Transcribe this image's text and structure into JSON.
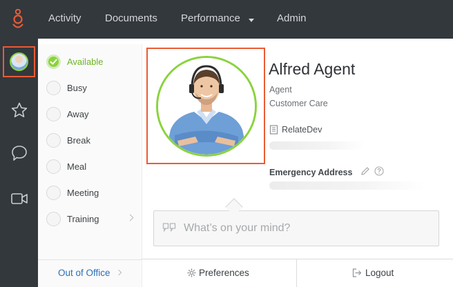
{
  "topbar": {
    "logo_icon": "genesys-logo-icon",
    "accent": "#ea5b34",
    "nav": [
      {
        "label": "Activity"
      },
      {
        "label": "Documents"
      },
      {
        "label": "Performance"
      },
      {
        "label": "Admin"
      }
    ]
  },
  "rail": {
    "items": [
      {
        "icon": "agent-avatar-icon"
      },
      {
        "icon": "star-icon"
      },
      {
        "icon": "chat-bubble-icon"
      },
      {
        "icon": "video-camera-icon"
      }
    ]
  },
  "status": {
    "items": [
      {
        "label": "Available",
        "selected": true
      },
      {
        "label": "Busy"
      },
      {
        "label": "Away"
      },
      {
        "label": "Break"
      },
      {
        "label": "Meal"
      },
      {
        "label": "Meeting"
      },
      {
        "label": "Training"
      }
    ],
    "out_of_office": "Out of Office",
    "selected_color": "#8ad33d"
  },
  "profile": {
    "name": "Alfred Agent",
    "title": "Agent",
    "department": "Customer Care",
    "organization": "RelateDev",
    "emergency_label": "Emergency Address"
  },
  "mind": {
    "placeholder": "What’s on your mind?"
  },
  "footer": {
    "preferences": "Preferences",
    "logout": "Logout"
  }
}
